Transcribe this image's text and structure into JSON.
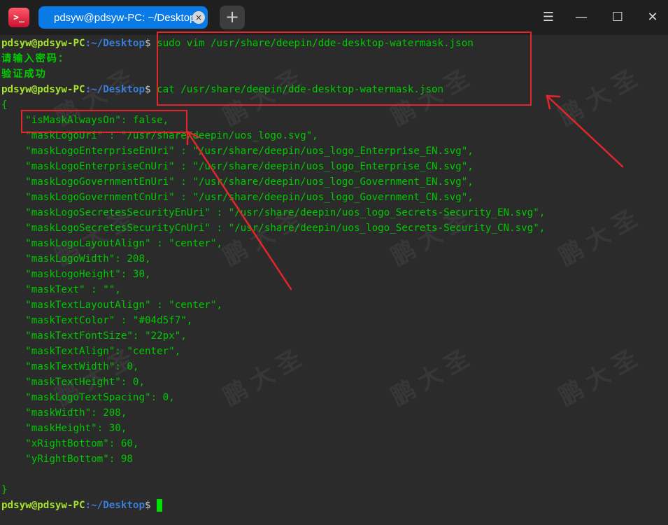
{
  "window": {
    "tab_title": "pdsyw@pdsyw-PC: ~/Desktop",
    "tab_close": "×",
    "new_tab": "+",
    "app_icon": ">_",
    "menu_icon": "☰",
    "minimize_icon": "—",
    "maximize_icon": "☐",
    "close_icon": "✕"
  },
  "terminal": {
    "prompt_user": "pdsyw@pdsyw-PC",
    "prompt_sep": ":",
    "prompt_path": "~/Desktop",
    "prompt_dollar": "$",
    "cmd1": " sudo vim /usr/share/deepin/dde-desktop-watermask.json",
    "password_prompt": "请输入密码：",
    "auth_success": "验证成功",
    "cmd2": " cat /usr/share/deepin/dde-desktop-watermask.json",
    "open_brace": "{",
    "close_brace": "}",
    "json_lines": [
      "    \"isMaskAlwaysOn\": false,",
      "    \"maskLogoUri\" : \"/usr/share/deepin/uos_logo.svg\",",
      "    \"maskLogoEnterpriseEnUri\" : \"/usr/share/deepin/uos_logo_Enterprise_EN.svg\",",
      "    \"maskLogoEnterpriseCnUri\" : \"/usr/share/deepin/uos_logo_Enterprise_CN.svg\",",
      "    \"maskLogoGovernmentEnUri\" : \"/usr/share/deepin/uos_logo_Government_EN.svg\",",
      "    \"maskLogoGovernmentCnUri\" : \"/usr/share/deepin/uos_logo_Government_CN.svg\",",
      "    \"maskLogoSecretesSecurityEnUri\" : \"/usr/share/deepin/uos_logo_Secrets-Security_EN.svg\",",
      "    \"maskLogoSecretesSecurityCnUri\" : \"/usr/share/deepin/uos_logo_Secrets-Security_CN.svg\",",
      "    \"maskLogoLayoutAlign\" : \"center\",",
      "    \"maskLogoWidth\": 208,",
      "    \"maskLogoHeight\": 30,",
      "    \"maskText\" : \"\",",
      "    \"maskTextLayoutAlign\" : \"center\",",
      "    \"maskTextColor\" : \"#04d5f7\",",
      "    \"maskTextFontSize\": \"22px\",",
      "    \"maskTextAlign\": \"center\",",
      "    \"maskTextWidth\": 0,",
      "    \"maskTextHeight\": 0,",
      "    \"maskLogoTextSpacing\": 0,",
      "    \"maskWidth\": 208,",
      "    \"maskHeight\": 30,",
      "    \"xRightBottom\": 60,",
      "    \"yRightBottom\": 98"
    ]
  },
  "watermark_text": [
    "鹏",
    "大",
    "圣"
  ],
  "colors": {
    "background": "#2b2b2b",
    "tab_accent": "#0a7ae6",
    "text_green": "#00c800",
    "prompt_user": "#a6e22e",
    "prompt_path": "#3b7dd8",
    "annotation_red": "#e3262c"
  }
}
